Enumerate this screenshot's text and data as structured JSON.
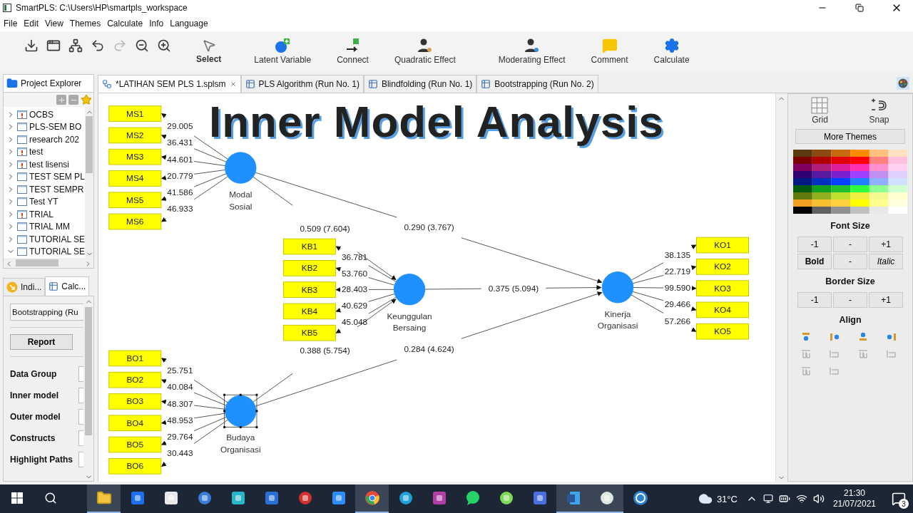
{
  "window": {
    "title": "SmartPLS: C:\\Users\\HP\\smartpls_workspace"
  },
  "menu": [
    "File",
    "Edit",
    "View",
    "Themes",
    "Calculate",
    "Info",
    "Language"
  ],
  "quick_actions": [
    {
      "disabled": false
    },
    {
      "disabled": false
    },
    {
      "disabled": false
    },
    {
      "disabled": false
    },
    {
      "disabled": true
    },
    {
      "disabled": false
    },
    {
      "disabled": false
    }
  ],
  "tools": [
    {
      "label": "Select",
      "selected": true
    },
    {
      "label": "Latent Variable",
      "selected": false
    },
    {
      "label": "Connect",
      "selected": false
    },
    {
      "label": "Quadratic Effect",
      "selected": false
    },
    {
      "label": "Moderating Effect",
      "selected": false
    },
    {
      "label": "Comment",
      "selected": false
    },
    {
      "label": "Calculate",
      "selected": false
    }
  ],
  "project_explorer": {
    "tab": "Project Explorer",
    "items": [
      {
        "label": "OCBS",
        "warning": true,
        "expanded": false
      },
      {
        "label": "PLS-SEM BO",
        "warning": false,
        "expanded": false
      },
      {
        "label": "research 202",
        "warning": false,
        "expanded": false
      },
      {
        "label": "test",
        "warning": true,
        "expanded": false
      },
      {
        "label": "test lisensi",
        "warning": true,
        "expanded": false
      },
      {
        "label": "TEST SEM PL",
        "warning": false,
        "expanded": false
      },
      {
        "label": "TEST SEMPR",
        "warning": false,
        "expanded": false
      },
      {
        "label": "Test YT",
        "warning": false,
        "expanded": false
      },
      {
        "label": "TRIAL",
        "warning": true,
        "expanded": false
      },
      {
        "label": "TRIAL MM",
        "warning": false,
        "expanded": false
      },
      {
        "label": "TUTORIAL SE",
        "warning": false,
        "expanded": false
      },
      {
        "label": "TUTORIAL SE",
        "warning": false,
        "expanded": true
      }
    ]
  },
  "calc_panel": {
    "tabs": [
      {
        "label": "Indi...",
        "selected": false
      },
      {
        "label": "Calc...",
        "selected": true
      }
    ],
    "dropdown": "Bootstrapping (Ru",
    "report_button": "Report",
    "properties": [
      "Data Group",
      "Inner model",
      "Outer model",
      "Constructs",
      "Highlight Paths"
    ]
  },
  "editor_tabs": [
    {
      "label": "*LATIHAN SEM PLS 1.splsm",
      "kind": "model",
      "selected": true
    },
    {
      "label": "PLS Algorithm (Run No. 1)",
      "kind": "result",
      "selected": false
    },
    {
      "label": "Blindfolding (Run No. 1)",
      "kind": "result",
      "selected": false
    },
    {
      "label": "Bootstrapping (Run No. 2)",
      "kind": "result",
      "selected": false
    }
  ],
  "overlay_title": "Inner Model Analysis",
  "model": {
    "constructs": [
      {
        "name_lines": [
          "Modal",
          "Sosial"
        ],
        "selected": false,
        "indicators": [
          {
            "label": "MS1",
            "loading": "29.005"
          },
          {
            "label": "MS2",
            "loading": "36.431"
          },
          {
            "label": "MS3",
            "loading": "44.601"
          },
          {
            "label": "MS4",
            "loading": "20.779"
          },
          {
            "label": "MS5",
            "loading": "41.586"
          },
          {
            "label": "MS6",
            "loading": "46.933"
          }
        ]
      },
      {
        "name_lines": [
          "Keunggulan",
          "Bersaing"
        ],
        "selected": false,
        "indicators": [
          {
            "label": "KB1",
            "loading": "36.781"
          },
          {
            "label": "KB2",
            "loading": "53.760"
          },
          {
            "label": "KB3",
            "loading": "28.403"
          },
          {
            "label": "KB4",
            "loading": "40.629"
          },
          {
            "label": "KB5",
            "loading": "45.048"
          }
        ]
      },
      {
        "name_lines": [
          "Budaya",
          "Organisasi"
        ],
        "selected": true,
        "indicators": [
          {
            "label": "BO1",
            "loading": "25.751"
          },
          {
            "label": "BO2",
            "loading": "40.084"
          },
          {
            "label": "BO3",
            "loading": "48.307"
          },
          {
            "label": "BO4",
            "loading": "48.953"
          },
          {
            "label": "BO5",
            "loading": "29.764"
          },
          {
            "label": "BO6",
            "loading": "30.443"
          }
        ]
      },
      {
        "name_lines": [
          "Kinerja",
          "Organisasi"
        ],
        "selected": false,
        "indicators": [
          {
            "label": "KO1",
            "loading": "38.135"
          },
          {
            "label": "KO2",
            "loading": "22.719"
          },
          {
            "label": "KO3",
            "loading": "99.590"
          },
          {
            "label": "KO4",
            "loading": "29.466"
          },
          {
            "label": "KO5",
            "loading": "57.266"
          }
        ]
      }
    ],
    "paths": [
      {
        "label": "0.509 (7.604)"
      },
      {
        "label": "0.290 (3.767)"
      },
      {
        "label": "0.375 (5.094)"
      },
      {
        "label": "0.388 (5.754)"
      },
      {
        "label": "0.284 (4.624)"
      }
    ]
  },
  "style_panel": {
    "grid": "Grid",
    "snap": "Snap",
    "more_themes": "More Themes",
    "font_size_title": "Font Size",
    "font_buttons": [
      "-1",
      "-",
      "+1",
      "Bold",
      "-",
      "Italic"
    ],
    "border_size_title": "Border Size",
    "border_buttons": [
      "-1",
      "-",
      "+1"
    ],
    "align_title": "Align"
  },
  "taskbar": {
    "apps": [
      {
        "active": true
      },
      {
        "active": false
      },
      {
        "active": false
      },
      {
        "active": false
      },
      {
        "active": false
      },
      {
        "active": false
      },
      {
        "active": false
      },
      {
        "active": false
      },
      {
        "active": true
      },
      {
        "active": false
      },
      {
        "active": false
      },
      {
        "active": false
      },
      {
        "active": false
      },
      {
        "active": false
      },
      {
        "active": true
      },
      {
        "active": true
      },
      {
        "active": false
      }
    ],
    "weather": "31°C",
    "time": "21:30",
    "date": "21/07/2021",
    "notifications": "3"
  }
}
